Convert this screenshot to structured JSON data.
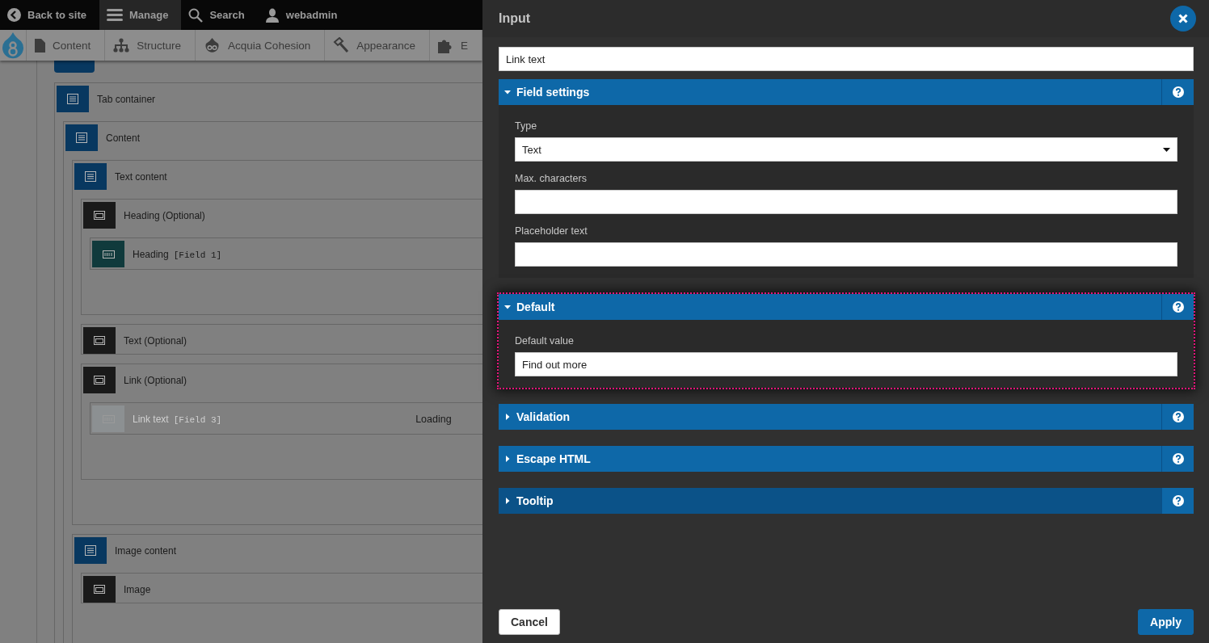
{
  "toolbar": {
    "items": [
      {
        "label": "Back to site",
        "kind": "back",
        "selected": false
      },
      {
        "label": "Manage",
        "kind": "menu",
        "selected": true
      },
      {
        "label": "Search",
        "kind": "search",
        "selected": false
      },
      {
        "label": "webadmin",
        "kind": "user",
        "selected": false
      }
    ]
  },
  "tray": {
    "items": [
      {
        "label": "Content",
        "kind": "file"
      },
      {
        "label": "Structure",
        "kind": "tree"
      },
      {
        "label": "Acquia Cohesion",
        "kind": "drop"
      },
      {
        "label": "Appearance",
        "kind": "brush"
      },
      {
        "label": "E",
        "kind": "puzzle"
      }
    ]
  },
  "layout_tree": [
    {
      "kind": "container",
      "label": "Tab container",
      "children": [
        {
          "kind": "container",
          "label": "Content",
          "children": [
            {
              "kind": "container",
              "label": "Text content",
              "children": [
                {
                  "kind": "element",
                  "label": "Heading (Optional)",
                  "children": [
                    {
                      "kind": "field",
                      "label": "Heading",
                      "tag": "[Field 1]",
                      "disabled": false
                    }
                  ]
                },
                {
                  "kind": "element",
                  "label": "Text (Optional)"
                },
                {
                  "kind": "element",
                  "label": "Link (Optional)",
                  "children": [
                    {
                      "kind": "field",
                      "label": "Link text",
                      "tag": "[Field 3]",
                      "disabled": true,
                      "status": "Loading"
                    }
                  ]
                }
              ]
            },
            {
              "kind": "container",
              "label": "Image content",
              "children": [
                {
                  "kind": "element",
                  "label": "Image"
                }
              ]
            }
          ]
        }
      ]
    }
  ],
  "panel": {
    "title": "Input",
    "title_field": {
      "value": "Link text"
    },
    "sections": [
      {
        "title": "Field settings",
        "expanded": true,
        "highlighted": false,
        "hovered": false,
        "fields": [
          {
            "kind": "select",
            "label": "Type",
            "value": "Text"
          },
          {
            "kind": "text",
            "label": "Max. characters"
          },
          {
            "kind": "text",
            "label": "Placeholder text"
          }
        ]
      },
      {
        "title": "Default",
        "expanded": true,
        "highlighted": true,
        "hovered": false,
        "fields": [
          {
            "kind": "text",
            "label": "Default value",
            "value": "Find out more"
          }
        ]
      },
      {
        "title": "Validation",
        "expanded": false,
        "highlighted": false,
        "hovered": false
      },
      {
        "title": "Escape HTML",
        "expanded": false,
        "highlighted": false,
        "hovered": false
      },
      {
        "title": "Tooltip",
        "expanded": false,
        "highlighted": false,
        "hovered": true
      }
    ],
    "buttons": [
      {
        "label": "Cancel",
        "kind": "secondary"
      },
      {
        "label": "Apply",
        "kind": "primary"
      }
    ]
  }
}
